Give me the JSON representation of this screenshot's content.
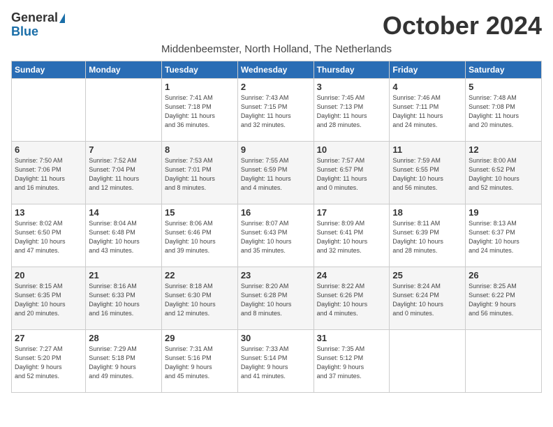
{
  "header": {
    "logo_general": "General",
    "logo_blue": "Blue",
    "month_title": "October 2024",
    "subtitle": "Middenbeemster, North Holland, The Netherlands"
  },
  "weekdays": [
    "Sunday",
    "Monday",
    "Tuesday",
    "Wednesday",
    "Thursday",
    "Friday",
    "Saturday"
  ],
  "weeks": [
    [
      {
        "day": "",
        "info": ""
      },
      {
        "day": "",
        "info": ""
      },
      {
        "day": "1",
        "info": "Sunrise: 7:41 AM\nSunset: 7:18 PM\nDaylight: 11 hours\nand 36 minutes."
      },
      {
        "day": "2",
        "info": "Sunrise: 7:43 AM\nSunset: 7:15 PM\nDaylight: 11 hours\nand 32 minutes."
      },
      {
        "day": "3",
        "info": "Sunrise: 7:45 AM\nSunset: 7:13 PM\nDaylight: 11 hours\nand 28 minutes."
      },
      {
        "day": "4",
        "info": "Sunrise: 7:46 AM\nSunset: 7:11 PM\nDaylight: 11 hours\nand 24 minutes."
      },
      {
        "day": "5",
        "info": "Sunrise: 7:48 AM\nSunset: 7:08 PM\nDaylight: 11 hours\nand 20 minutes."
      }
    ],
    [
      {
        "day": "6",
        "info": "Sunrise: 7:50 AM\nSunset: 7:06 PM\nDaylight: 11 hours\nand 16 minutes."
      },
      {
        "day": "7",
        "info": "Sunrise: 7:52 AM\nSunset: 7:04 PM\nDaylight: 11 hours\nand 12 minutes."
      },
      {
        "day": "8",
        "info": "Sunrise: 7:53 AM\nSunset: 7:01 PM\nDaylight: 11 hours\nand 8 minutes."
      },
      {
        "day": "9",
        "info": "Sunrise: 7:55 AM\nSunset: 6:59 PM\nDaylight: 11 hours\nand 4 minutes."
      },
      {
        "day": "10",
        "info": "Sunrise: 7:57 AM\nSunset: 6:57 PM\nDaylight: 11 hours\nand 0 minutes."
      },
      {
        "day": "11",
        "info": "Sunrise: 7:59 AM\nSunset: 6:55 PM\nDaylight: 10 hours\nand 56 minutes."
      },
      {
        "day": "12",
        "info": "Sunrise: 8:00 AM\nSunset: 6:52 PM\nDaylight: 10 hours\nand 52 minutes."
      }
    ],
    [
      {
        "day": "13",
        "info": "Sunrise: 8:02 AM\nSunset: 6:50 PM\nDaylight: 10 hours\nand 47 minutes."
      },
      {
        "day": "14",
        "info": "Sunrise: 8:04 AM\nSunset: 6:48 PM\nDaylight: 10 hours\nand 43 minutes."
      },
      {
        "day": "15",
        "info": "Sunrise: 8:06 AM\nSunset: 6:46 PM\nDaylight: 10 hours\nand 39 minutes."
      },
      {
        "day": "16",
        "info": "Sunrise: 8:07 AM\nSunset: 6:43 PM\nDaylight: 10 hours\nand 35 minutes."
      },
      {
        "day": "17",
        "info": "Sunrise: 8:09 AM\nSunset: 6:41 PM\nDaylight: 10 hours\nand 32 minutes."
      },
      {
        "day": "18",
        "info": "Sunrise: 8:11 AM\nSunset: 6:39 PM\nDaylight: 10 hours\nand 28 minutes."
      },
      {
        "day": "19",
        "info": "Sunrise: 8:13 AM\nSunset: 6:37 PM\nDaylight: 10 hours\nand 24 minutes."
      }
    ],
    [
      {
        "day": "20",
        "info": "Sunrise: 8:15 AM\nSunset: 6:35 PM\nDaylight: 10 hours\nand 20 minutes."
      },
      {
        "day": "21",
        "info": "Sunrise: 8:16 AM\nSunset: 6:33 PM\nDaylight: 10 hours\nand 16 minutes."
      },
      {
        "day": "22",
        "info": "Sunrise: 8:18 AM\nSunset: 6:30 PM\nDaylight: 10 hours\nand 12 minutes."
      },
      {
        "day": "23",
        "info": "Sunrise: 8:20 AM\nSunset: 6:28 PM\nDaylight: 10 hours\nand 8 minutes."
      },
      {
        "day": "24",
        "info": "Sunrise: 8:22 AM\nSunset: 6:26 PM\nDaylight: 10 hours\nand 4 minutes."
      },
      {
        "day": "25",
        "info": "Sunrise: 8:24 AM\nSunset: 6:24 PM\nDaylight: 10 hours\nand 0 minutes."
      },
      {
        "day": "26",
        "info": "Sunrise: 8:25 AM\nSunset: 6:22 PM\nDaylight: 9 hours\nand 56 minutes."
      }
    ],
    [
      {
        "day": "27",
        "info": "Sunrise: 7:27 AM\nSunset: 5:20 PM\nDaylight: 9 hours\nand 52 minutes."
      },
      {
        "day": "28",
        "info": "Sunrise: 7:29 AM\nSunset: 5:18 PM\nDaylight: 9 hours\nand 49 minutes."
      },
      {
        "day": "29",
        "info": "Sunrise: 7:31 AM\nSunset: 5:16 PM\nDaylight: 9 hours\nand 45 minutes."
      },
      {
        "day": "30",
        "info": "Sunrise: 7:33 AM\nSunset: 5:14 PM\nDaylight: 9 hours\nand 41 minutes."
      },
      {
        "day": "31",
        "info": "Sunrise: 7:35 AM\nSunset: 5:12 PM\nDaylight: 9 hours\nand 37 minutes."
      },
      {
        "day": "",
        "info": ""
      },
      {
        "day": "",
        "info": ""
      }
    ]
  ]
}
